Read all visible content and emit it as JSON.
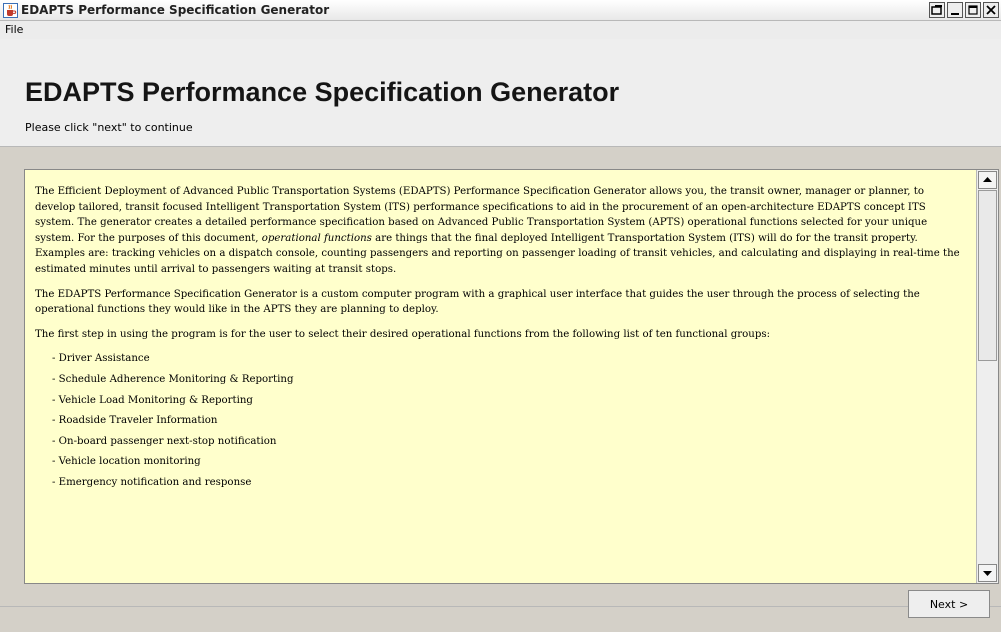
{
  "window": {
    "title": "EDAPTS Performance Specification Generator",
    "icons": {
      "app": "java-cup-icon",
      "restore": "restore-icon",
      "minimize": "minimize-icon",
      "maximize": "maximize-icon",
      "close": "close-icon"
    }
  },
  "menubar": {
    "file": "File"
  },
  "header": {
    "title": "EDAPTS Performance Specification Generator",
    "subtitle": "Please click \"next\" to continue"
  },
  "content": {
    "p1_a": "The Efficient Deployment of Advanced Public Transportation Systems (EDAPTS) Performance Specification Generator allows you, the transit owner, manager or planner, to develop tailored, transit focused Intelligent Transportation System (ITS) performance specifications to aid in the procurement of an open-architecture EDAPTS concept ITS system.  The generator creates a detailed performance specification based on Advanced Public Transportation System (APTS) operational functions selected for your unique system.  For the purposes of this document, ",
    "p1_em1": "operational",
    "p1_space": " ",
    "p1_em2": "functions",
    "p1_b": " are things that the final deployed Intelligent Transportation System (ITS) will do for the transit property.  Examples are: tracking vehicles on a dispatch console, counting passengers and reporting on passenger loading of transit vehicles, and calculating and displaying in real-time the estimated minutes until arrival to passengers waiting at transit stops.",
    "p2": "The EDAPTS Performance Specification Generator is a custom computer program with a graphical user interface that guides the user through the process of selecting the operational functions they would like in the APTS they are planning to deploy.",
    "p3": "The first step in using the program is for the user to select their desired operational functions from the following list of ten functional groups:",
    "groups": [
      "-  Driver Assistance",
      "-  Schedule Adherence Monitoring & Reporting",
      "-  Vehicle Load Monitoring & Reporting",
      "-  Roadside Traveler Information",
      "-  On-board passenger next-stop notification",
      "-  Vehicle location monitoring",
      "-  Emergency notification and response"
    ]
  },
  "footer": {
    "next_label": "Next >"
  }
}
